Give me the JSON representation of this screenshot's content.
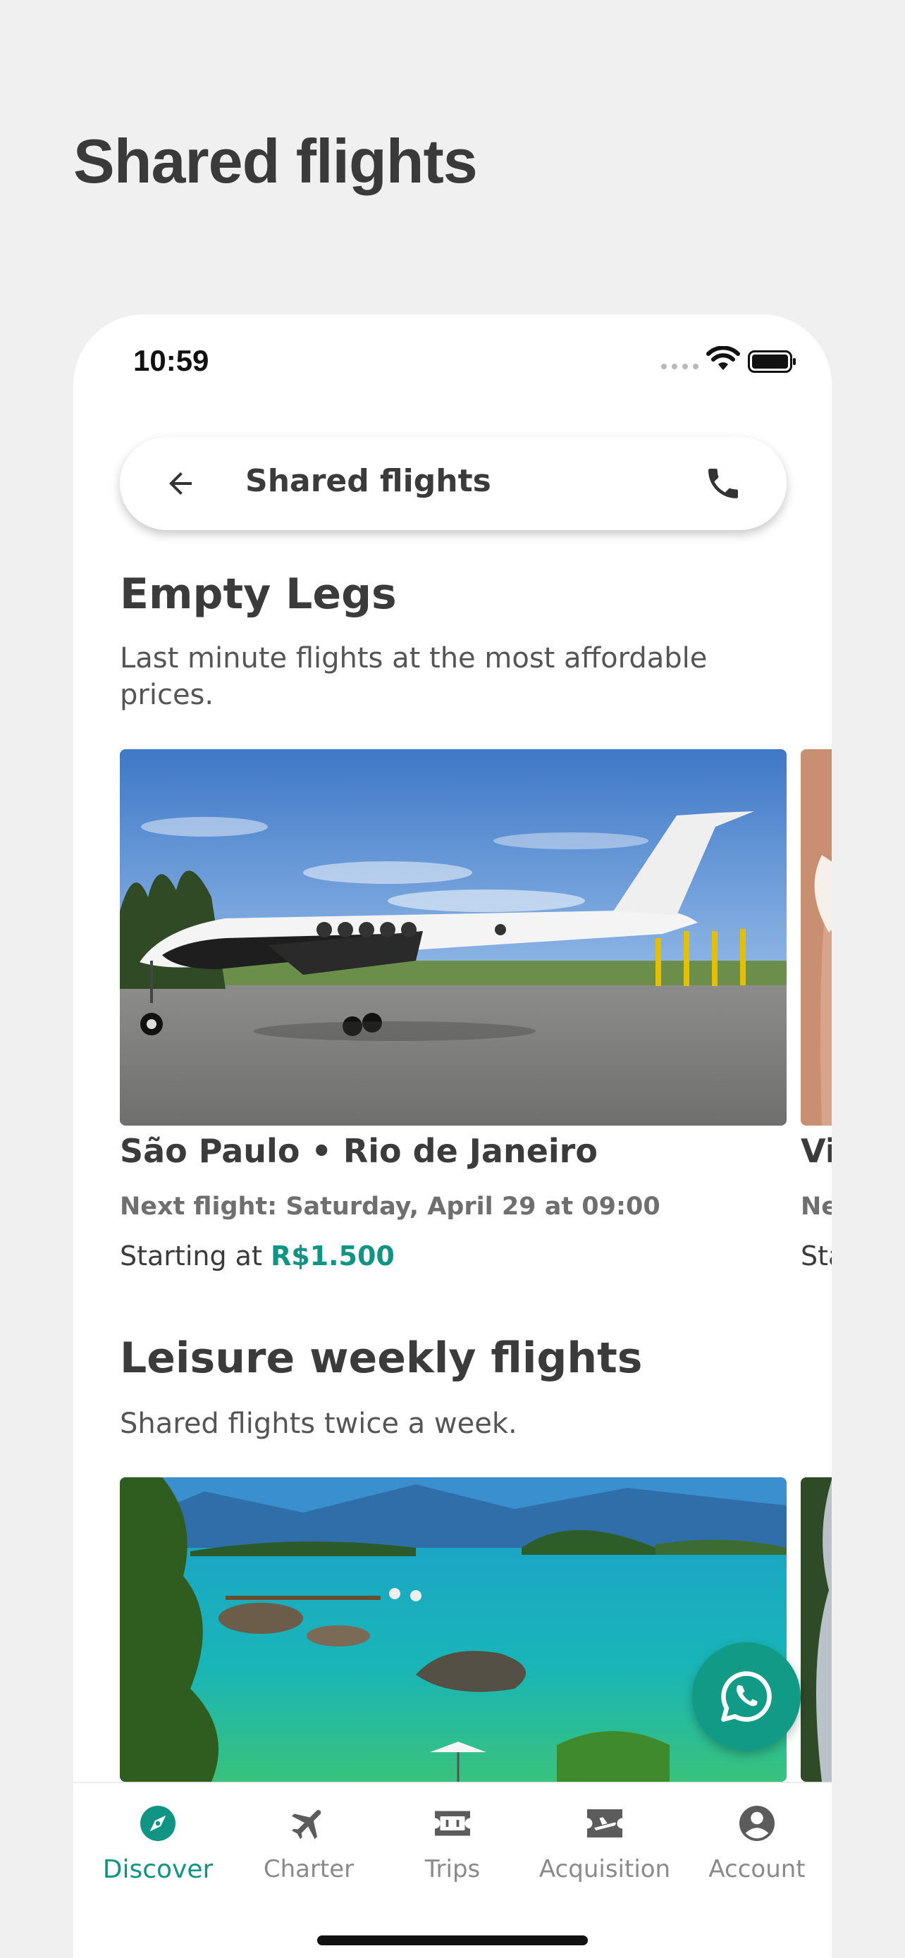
{
  "page": {
    "title": "Shared flights"
  },
  "status_bar": {
    "time": "10:59"
  },
  "top_bar": {
    "title": "Shared flights",
    "back_icon": "arrow-left-icon",
    "call_icon": "phone-icon"
  },
  "empty_legs": {
    "title": "Empty Legs",
    "subtitle": "Last minute flights at the most affordable prices.",
    "card": {
      "route": "São Paulo • Rio de Janeiro",
      "next_flight": "Next flight: Saturday, April 29 at 09:00",
      "price_prefix": "Starting at ",
      "price": "R$1.500"
    },
    "peek": {
      "route": "Vi",
      "next": "Ne",
      "price": "Sta"
    }
  },
  "leisure": {
    "title": "Leisure weekly flights",
    "subtitle": "Shared flights twice a week."
  },
  "fab": {
    "icon": "whatsapp-icon"
  },
  "bottom_nav": {
    "items": [
      {
        "label": "Discover",
        "icon": "compass-icon",
        "active": true
      },
      {
        "label": "Charter",
        "icon": "airplane-icon",
        "active": false
      },
      {
        "label": "Trips",
        "icon": "ticket-icon",
        "active": false
      },
      {
        "label": "Acquisition",
        "icon": "airplane-ticket-icon",
        "active": false
      },
      {
        "label": "Account",
        "icon": "account-circle-icon",
        "active": false
      }
    ]
  },
  "colors": {
    "accent": "#109484",
    "fab": "#119a86",
    "background": "#f0f0f0",
    "text": "#3b3b3b"
  }
}
